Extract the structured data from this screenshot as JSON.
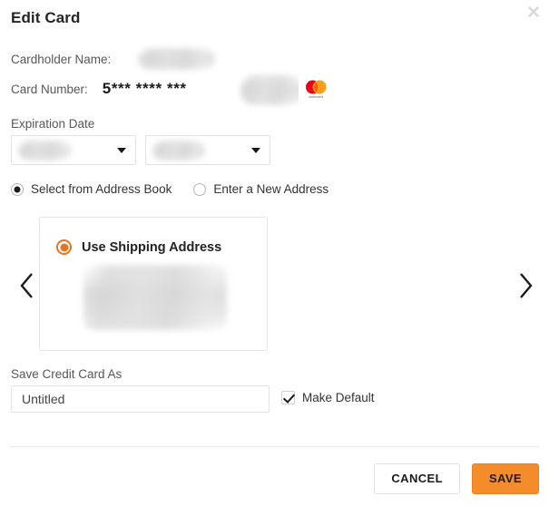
{
  "dialog": {
    "title": "Edit Card",
    "close_icon": "close-icon"
  },
  "fields": {
    "cardholder_name_label": "Cardholder Name:",
    "cardholder_name_value": "",
    "card_number_label": "Card Number:",
    "card_number_value": "5*** **** ***",
    "card_brand": "mastercard",
    "expiration_label": "Expiration Date",
    "expiration_month_value": "",
    "expiration_year_value": "",
    "caret_icon": "chevron-down-icon"
  },
  "address_mode": {
    "options": [
      {
        "label": "Select from Address Book",
        "selected": true
      },
      {
        "label": "Enter a New Address",
        "selected": false
      }
    ]
  },
  "carousel": {
    "prev_icon": "chevron-left-icon",
    "next_icon": "chevron-right-icon"
  },
  "address_card": {
    "title": "Use Shipping Address",
    "selected": true,
    "address_lines": ""
  },
  "save_as": {
    "label": "Save Credit Card As",
    "value": "Untitled",
    "placeholder": "Untitled",
    "make_default_label": "Make Default",
    "make_default_checked": true
  },
  "footer": {
    "cancel_label": "CANCEL",
    "save_label": "SAVE"
  },
  "colors": {
    "accent_orange": "#f58c2c",
    "radio_orange": "#e8741e",
    "label_gray": "#575757",
    "border_gray": "#e2e2e2",
    "mastercard_red": "#eb001b",
    "mastercard_orange": "#f79e1b",
    "close_gray": "#d6d9de"
  }
}
